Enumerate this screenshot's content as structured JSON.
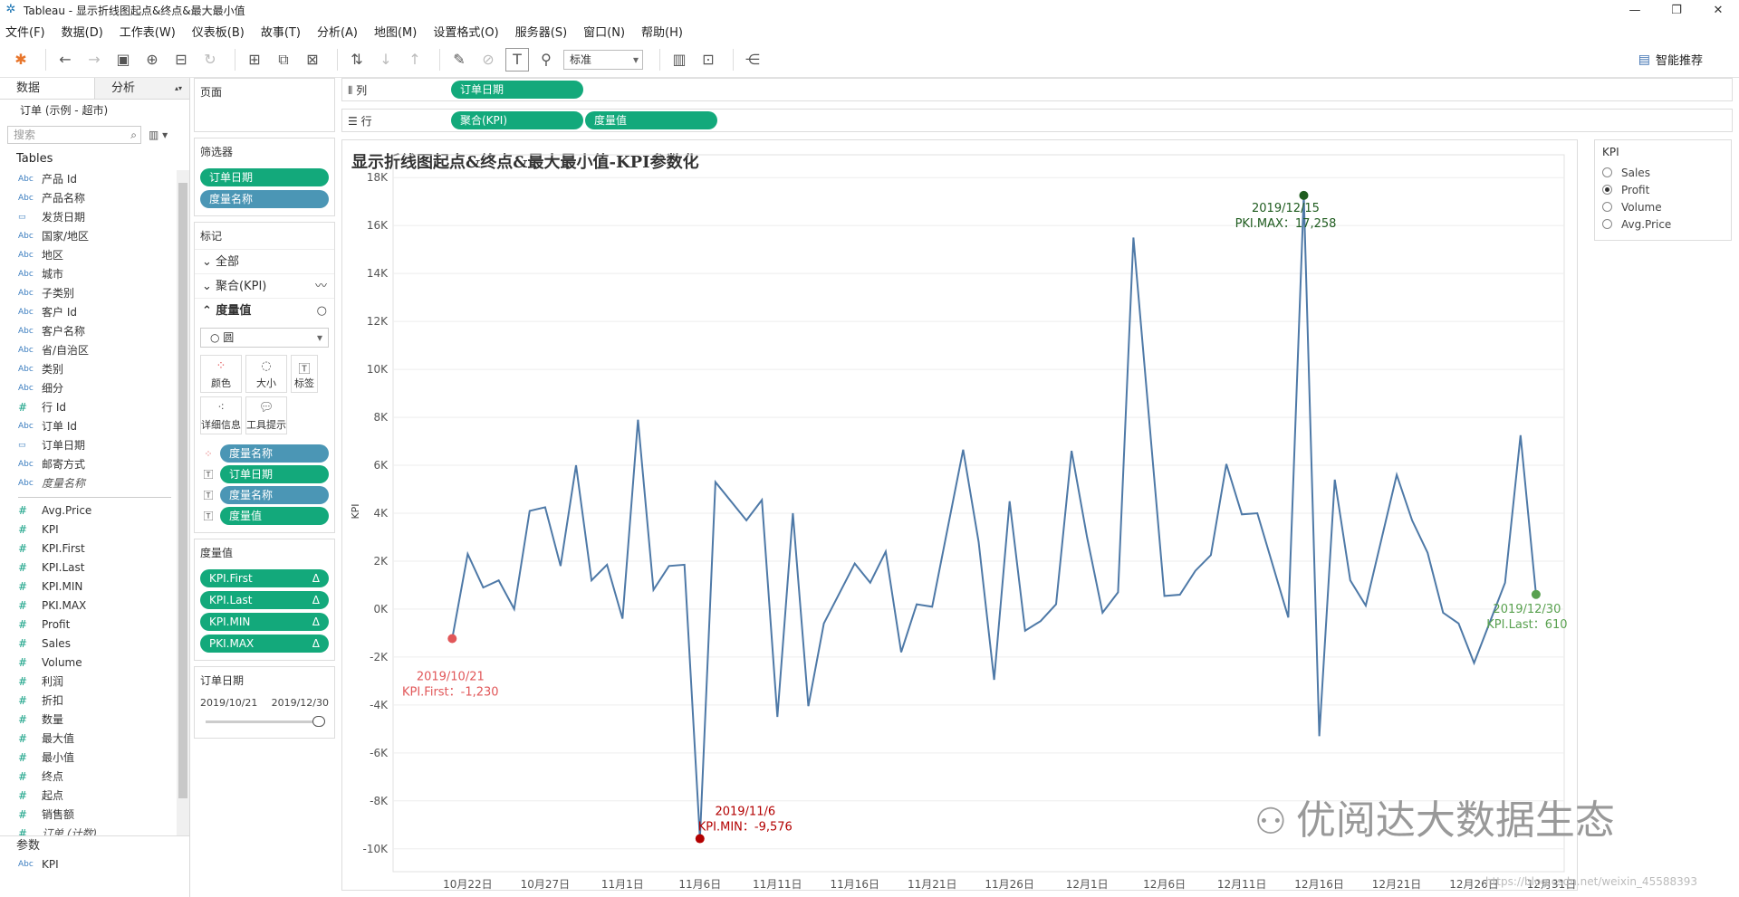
{
  "window": {
    "title": "Tableau - 显示折线图起点&终点&最大最小值",
    "controls": [
      "—",
      "❐",
      "✕"
    ]
  },
  "menu": [
    "文件(F)",
    "数据(D)",
    "工作表(W)",
    "仪表板(B)",
    "故事(T)",
    "分析(A)",
    "地图(M)",
    "设置格式(O)",
    "服务器(S)",
    "窗口(N)",
    "帮助(H)"
  ],
  "toolbar": {
    "fit_select": "标准",
    "smart_recommend": "智能推荐"
  },
  "left": {
    "tab_data": "数据",
    "tab_analysis": "分析",
    "datasource": "订单 (示例 - 超市)",
    "search_placeholder": "搜索",
    "tables_heading": "Tables",
    "dimensions": [
      {
        "type": "Abc",
        "name": "产品 Id"
      },
      {
        "type": "Abc",
        "name": "产品名称"
      },
      {
        "type": "date",
        "name": "发货日期"
      },
      {
        "type": "Abc",
        "name": "国家/地区"
      },
      {
        "type": "Abc",
        "name": "地区"
      },
      {
        "type": "Abc",
        "name": "城市"
      },
      {
        "type": "Abc",
        "name": "子类别"
      },
      {
        "type": "Abc",
        "name": "客户 Id"
      },
      {
        "type": "Abc",
        "name": "客户名称"
      },
      {
        "type": "Abc",
        "name": "省/自治区"
      },
      {
        "type": "Abc",
        "name": "类别"
      },
      {
        "type": "Abc",
        "name": "细分"
      },
      {
        "type": "#",
        "name": "行 Id"
      },
      {
        "type": "Abc",
        "name": "订单 Id"
      },
      {
        "type": "date",
        "name": "订单日期"
      },
      {
        "type": "Abc",
        "name": "邮寄方式"
      },
      {
        "type": "Abc",
        "name": "度量名称",
        "italic": true
      }
    ],
    "measures": [
      {
        "type": "#",
        "name": "Avg.Price"
      },
      {
        "type": "#",
        "name": "KPI"
      },
      {
        "type": "#",
        "name": "KPI.First"
      },
      {
        "type": "#",
        "name": "KPI.Last"
      },
      {
        "type": "#",
        "name": "KPI.MIN"
      },
      {
        "type": "#",
        "name": "PKI.MAX"
      },
      {
        "type": "#",
        "name": "Profit"
      },
      {
        "type": "#",
        "name": "Sales"
      },
      {
        "type": "#",
        "name": "Volume"
      },
      {
        "type": "#",
        "name": "利润"
      },
      {
        "type": "#",
        "name": "折扣"
      },
      {
        "type": "#",
        "name": "数量"
      },
      {
        "type": "#",
        "name": "最大值"
      },
      {
        "type": "#",
        "name": "最小值"
      },
      {
        "type": "#",
        "name": "终点"
      },
      {
        "type": "#",
        "name": "起点"
      },
      {
        "type": "#",
        "name": "销售额"
      },
      {
        "type": "#",
        "name": "订单 (计数)",
        "italic": true
      }
    ],
    "params_heading": "参数",
    "params": [
      {
        "type": "Abc",
        "name": "KPI"
      }
    ]
  },
  "mid": {
    "pages_title": "页面",
    "filters_title": "筛选器",
    "filters": [
      "订单日期",
      "度量名称"
    ],
    "marks_title": "标记",
    "marks_all": "全部",
    "marks_agg": "聚合(KPI)",
    "marks_measure": "度量值",
    "mark_type": "圆",
    "btn_color": "颜色",
    "btn_size": "大小",
    "btn_label": "标签",
    "btn_detail": "详细信息",
    "btn_tooltip": "工具提示",
    "mark_pills": [
      "度量名称",
      "订单日期",
      "度量名称",
      "度量值"
    ],
    "measures_title": "度量值",
    "measure_pills": [
      "KPI.First",
      "KPI.Last",
      "KPI.MIN",
      "PKI.MAX"
    ],
    "delta": "Δ",
    "date_filter_title": "订单日期",
    "date_from": "2019/10/21",
    "date_to": "2019/12/30"
  },
  "shelves": {
    "columns_label": "列",
    "columns_pill": "订单日期",
    "rows_label": "行",
    "rows_pills": [
      "聚合(KPI)",
      "度量值"
    ]
  },
  "viz": {
    "title": "显示折线图起点&终点&最大最小值-KPI参数化"
  },
  "kpi_param": {
    "title": "KPI",
    "options": [
      "Sales",
      "Profit",
      "Volume",
      "Avg.Price"
    ],
    "selected": "Profit"
  },
  "colors": {
    "line": "#4e79a7",
    "first": "#e15759",
    "min": "#b30000",
    "max": "#1f5c1f",
    "last": "#59a14f",
    "pill_green": "#13a97b",
    "pill_blue": "#4b96b5"
  },
  "chart_data": {
    "type": "line",
    "ylabel": "KPI",
    "ylim": [
      -10500,
      18500
    ],
    "yticks": [
      -10000,
      -8000,
      -6000,
      -4000,
      -2000,
      0,
      2000,
      4000,
      6000,
      8000,
      10000,
      12000,
      14000,
      16000,
      18000
    ],
    "ytick_labels": [
      "-10K",
      "-8K",
      "-6K",
      "-4K",
      "-2K",
      "0K",
      "2K",
      "4K",
      "6K",
      "8K",
      "10K",
      "12K",
      "14K",
      "16K",
      "18K"
    ],
    "xticks": [
      "2019-10-22",
      "2019-10-27",
      "2019-11-01",
      "2019-11-06",
      "2019-11-11",
      "2019-11-16",
      "2019-11-21",
      "2019-11-26",
      "2019-12-01",
      "2019-12-06",
      "2019-12-11",
      "2019-12-16",
      "2019-12-21",
      "2019-12-26",
      "2019-12-31"
    ],
    "xtick_labels": [
      "10月22日",
      "10月27日",
      "11月1日",
      "11月6日",
      "11月11日",
      "11月16日",
      "11月21日",
      "11月26日",
      "12月1日",
      "12月6日",
      "12月11日",
      "12月16日",
      "12月21日",
      "12月26日",
      "12月31日"
    ],
    "xlim": [
      "2019-10-18",
      "2019-12-31"
    ],
    "grid": true,
    "series": [
      {
        "x": [
          "2019-10-21",
          "2019-10-22",
          "2019-10-23",
          "2019-10-24",
          "2019-10-25",
          "2019-10-26",
          "2019-10-27",
          "2019-10-28",
          "2019-10-29",
          "2019-10-30",
          "2019-10-31",
          "2019-11-01",
          "2019-11-02",
          "2019-11-03",
          "2019-11-04",
          "2019-11-05",
          "2019-11-06",
          "2019-11-07",
          "2019-11-09",
          "2019-11-10",
          "2019-11-11",
          "2019-11-12",
          "2019-11-13",
          "2019-11-14",
          "2019-11-16",
          "2019-11-17",
          "2019-11-18",
          "2019-11-19",
          "2019-11-20",
          "2019-11-21",
          "2019-11-23",
          "2019-11-24",
          "2019-11-25",
          "2019-11-26",
          "2019-11-27",
          "2019-11-28",
          "2019-11-29",
          "2019-11-30",
          "2019-12-01",
          "2019-12-02",
          "2019-12-03",
          "2019-12-04",
          "2019-12-06",
          "2019-12-07",
          "2019-12-08",
          "2019-12-09",
          "2019-12-10",
          "2019-12-11",
          "2019-12-12",
          "2019-12-14",
          "2019-12-15",
          "2019-12-16",
          "2019-12-17",
          "2019-12-18",
          "2019-12-19",
          "2019-12-21",
          "2019-12-22",
          "2019-12-23",
          "2019-12-24",
          "2019-12-25",
          "2019-12-26",
          "2019-12-28",
          "2019-12-29",
          "2019-12-30"
        ],
        "y": [
          -1230,
          2300,
          900,
          1200,
          0,
          4100,
          4250,
          1800,
          6000,
          1200,
          1850,
          -400,
          7900,
          800,
          1800,
          1850,
          -9576,
          5300,
          3700,
          4550,
          -4500,
          4000,
          -4050,
          -600,
          1900,
          1100,
          2400,
          -1800,
          200,
          100,
          6650,
          2800,
          -2950,
          4500,
          -900,
          -500,
          200,
          6600,
          3000,
          -150,
          700,
          15500,
          550,
          600,
          1600,
          2250,
          6050,
          3950,
          4000,
          -350,
          17258,
          -5300,
          5400,
          1200,
          150,
          5600,
          3700,
          2350,
          -150,
          -600,
          -2250,
          1100,
          7250,
          610
        ]
      }
    ],
    "annotations": [
      {
        "kind": "first",
        "date_label": "2019/10/21",
        "value_label": "KPI.First：-1,230",
        "x": "2019-10-21",
        "y": -1230
      },
      {
        "kind": "min",
        "date_label": "2019/11/6",
        "value_label": "KPI.MIN：-9,576",
        "x": "2019-11-06",
        "y": -9576
      },
      {
        "kind": "max",
        "date_label": "2019/12/15",
        "value_label": "PKI.MAX：17,258",
        "x": "2019-12-15",
        "y": 17258
      },
      {
        "kind": "last",
        "date_label": "2019/12/30",
        "value_label": "KPI.Last：610",
        "x": "2019-12-30",
        "y": 610
      }
    ]
  },
  "watermark": {
    "text": "优阅达大数据生态",
    "url": "https://blog.csdn.net/weixin_45588393"
  }
}
